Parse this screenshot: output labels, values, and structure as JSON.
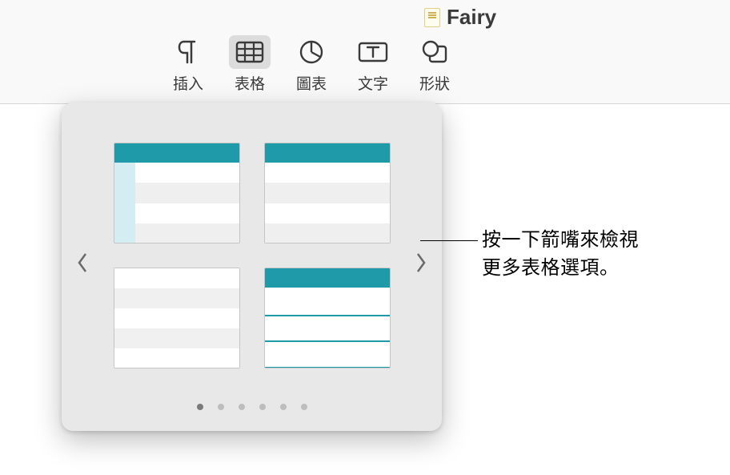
{
  "document": {
    "title": "Fairy "
  },
  "toolbar": {
    "insert": {
      "label": "插入"
    },
    "table": {
      "label": "表格",
      "active": true
    },
    "chart": {
      "label": "圖表"
    },
    "text": {
      "label": "文字"
    },
    "shape": {
      "label": "形狀"
    }
  },
  "popover": {
    "page_count": 6,
    "active_page_index": 0,
    "styles": [
      {
        "id": "table-style-1"
      },
      {
        "id": "table-style-2"
      },
      {
        "id": "table-style-3"
      },
      {
        "id": "table-style-4"
      }
    ]
  },
  "callout": {
    "line1": "按一下箭嘴來檢視",
    "line2": "更多表格選項。"
  },
  "colors": {
    "accent_teal": "#1f9aa8",
    "accent_light": "#d4edf2"
  }
}
